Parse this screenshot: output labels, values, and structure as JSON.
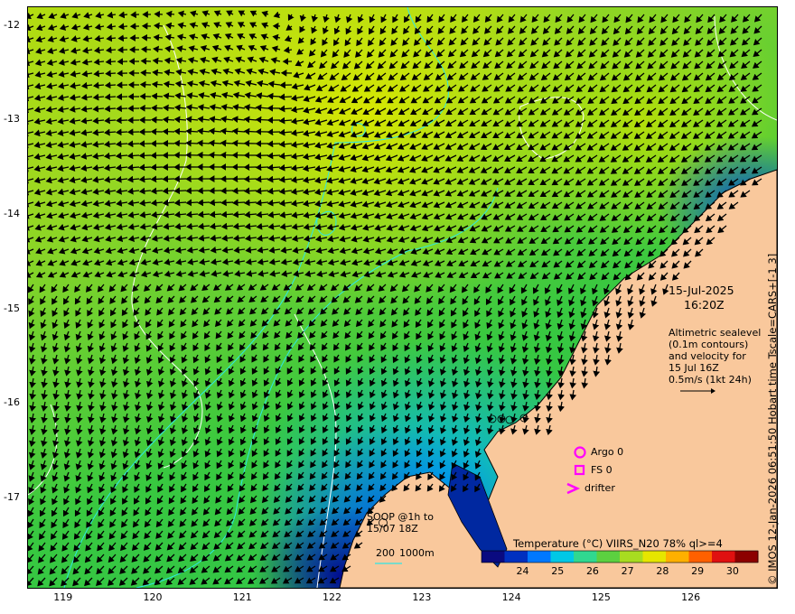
{
  "map": {
    "lat_ticks": [
      "-12",
      "-13",
      "-14",
      "-15",
      "-16",
      "-17"
    ],
    "lon_ticks": [
      "119",
      "120",
      "121",
      "122",
      "123",
      "124",
      "125",
      "126"
    ],
    "lat_range": [
      -11.8,
      -17.95
    ],
    "lon_range": [
      118.6,
      126.95
    ],
    "land_color": "#f9c89c",
    "contour_color": "#ffffff",
    "isobath_color": "#2ee6e6"
  },
  "annotations": {
    "date": "15-Jul-2025",
    "time": "16:20Z",
    "alt_line1": "Altimetric sealevel",
    "alt_line2": "(0.1m contours)",
    "alt_line3": "and velocity for",
    "alt_line4": "15 Jul 16Z",
    "alt_line5": "0.5m/s (1kt 24h)",
    "argo": "Argo 0",
    "fs": "FS 0",
    "drifter": "drifter",
    "soop_line1": "SOOP @1h to",
    "soop_line2": "15/07 18Z",
    "isobath_200": "200",
    "isobath_1000": "1000m"
  },
  "colorbar": {
    "title": "Temperature (°C) VIIRS_N20 78% ql>=4",
    "ticks": [
      "24",
      "25",
      "26",
      "27",
      "28",
      "29",
      "30"
    ],
    "colors": [
      "#0a0a80",
      "#0030c0",
      "#0078ff",
      "#00c8e6",
      "#30d890",
      "#5cd040",
      "#a8dc20",
      "#e6e600",
      "#ffb000",
      "#ff6000",
      "#e01010",
      "#8c0000"
    ]
  },
  "credit": "© IMOS 12-Jan-2026 06:51:50 Hobart time Tscale=CARS+[-1 3]"
}
